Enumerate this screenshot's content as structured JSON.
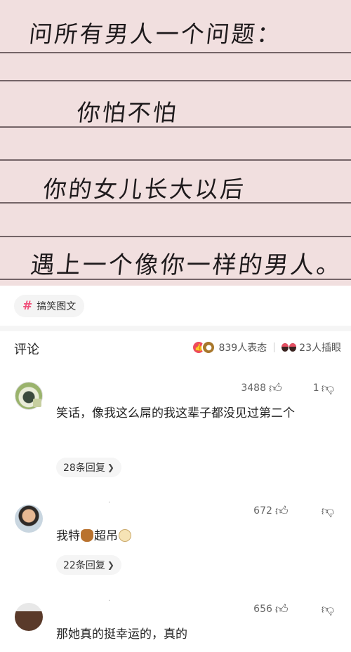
{
  "note": {
    "lines": [
      "问所有男人一个问题：",
      "你怕不怕",
      "你的女儿长大以后",
      "遇上一个像你一样的男人。"
    ]
  },
  "topic": {
    "icon": "hashtag-icon",
    "label": "搞笑图文"
  },
  "comments_header": {
    "title": "评论",
    "reactions_label": "839人表态",
    "peek_label": "23人插眼"
  },
  "comments": [
    {
      "likes": "3488",
      "dislikes": "1",
      "text": "笑话，像我这么屌的我这辈子都没见过第二个",
      "replies": "28条回复"
    },
    {
      "username": "·",
      "likes": "672",
      "dislikes": "",
      "text_before": "我特",
      "text_middle": "超吊",
      "replies": "22条回复"
    },
    {
      "username": "·",
      "likes": "656",
      "dislikes": "",
      "text": "那她真的挺幸运的，真的"
    }
  ],
  "colors": {
    "accent": "#f0507a",
    "note_background": "#f1dfdf",
    "chip_background": "#f4f4f4"
  }
}
